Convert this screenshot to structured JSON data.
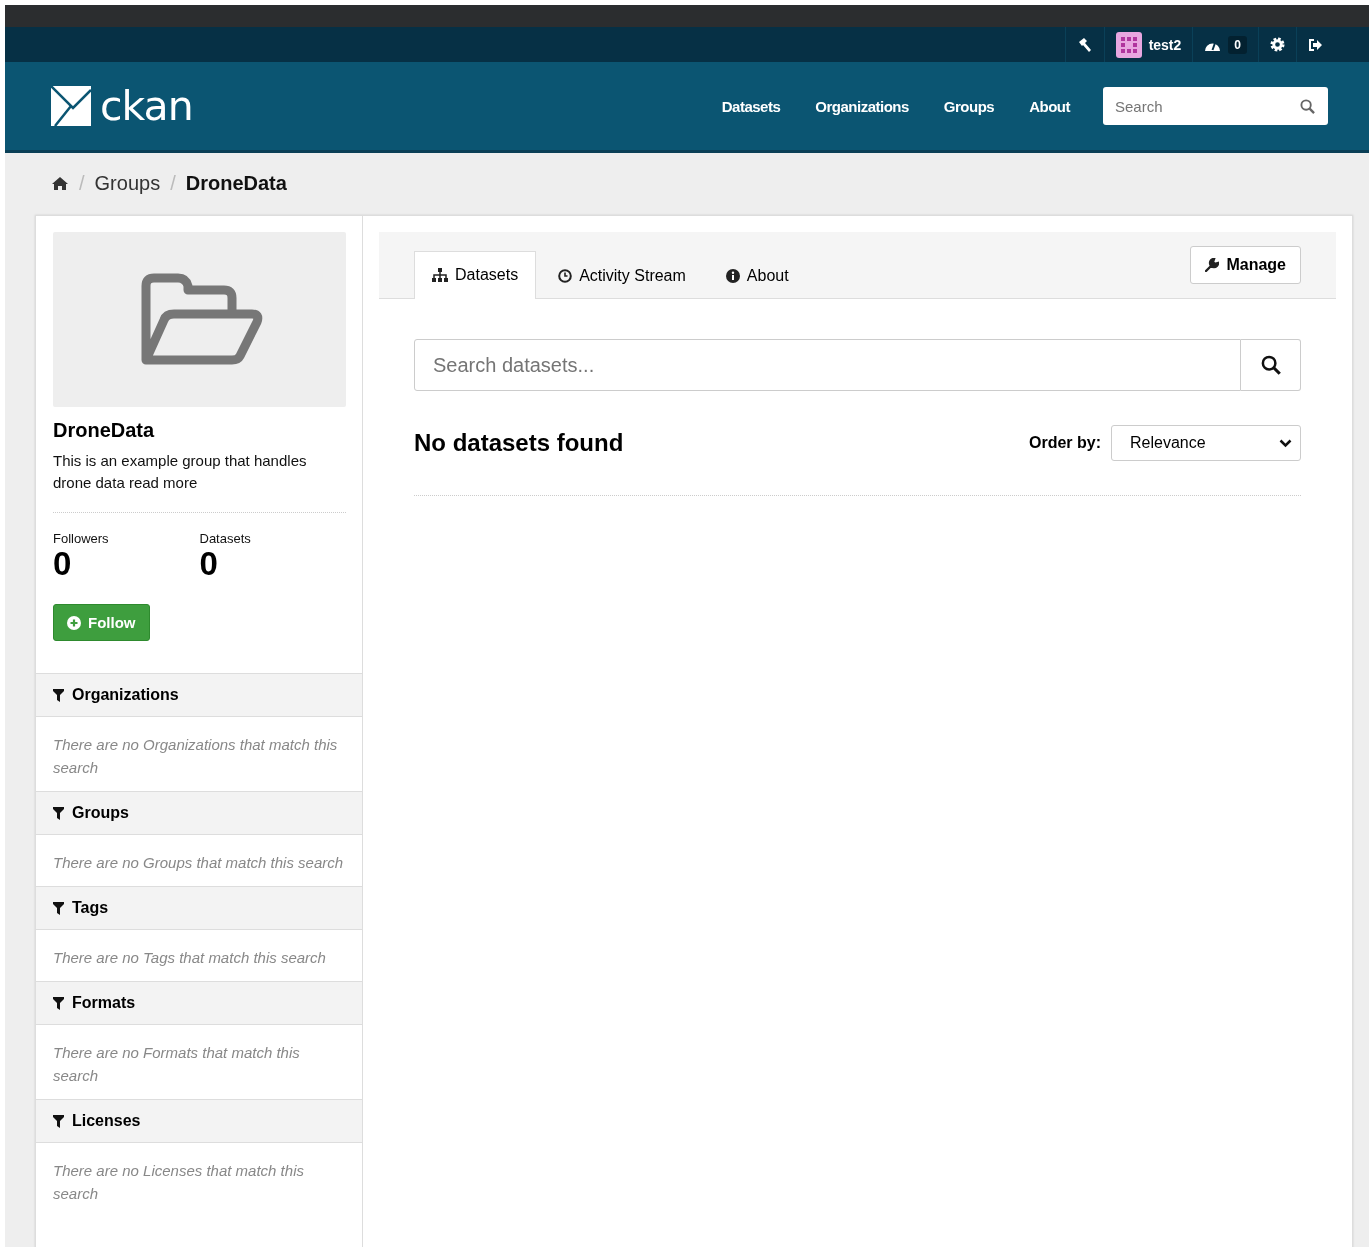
{
  "account_bar": {
    "user": "test2",
    "dashboard_count": "0"
  },
  "header": {
    "logo": "ckan",
    "nav": [
      {
        "label": "Datasets"
      },
      {
        "label": "Organizations"
      },
      {
        "label": "Groups"
      },
      {
        "label": "About"
      }
    ],
    "search": {
      "placeholder": "Search"
    }
  },
  "breadcrumb": [
    {
      "separator": "/",
      "label": "Groups"
    },
    {
      "separator": "/",
      "label": "DroneData"
    }
  ],
  "group": {
    "name": "DroneData",
    "description": "This is an example group that handles drone data read more",
    "stats": [
      {
        "label": "Followers",
        "value": "0"
      },
      {
        "label": "Datasets",
        "value": "0"
      }
    ],
    "follow_button": "Follow"
  },
  "facets": [
    {
      "title": "Organizations",
      "empty_text": "There are no Organizations that match this search"
    },
    {
      "title": "Groups",
      "empty_text": "There are no Groups that match this search"
    },
    {
      "title": "Tags",
      "empty_text": "There are no Tags that match this search"
    },
    {
      "title": "Formats",
      "empty_text": "There are no Formats that match this search"
    },
    {
      "title": "Licenses",
      "empty_text": "There are no Licenses that match this search"
    }
  ],
  "tabs": [
    {
      "label": "Datasets",
      "kind": "sitemap",
      "selected": true
    },
    {
      "label": "Activity Stream",
      "kind": "clock",
      "selected": false
    },
    {
      "label": "About",
      "kind": "info",
      "selected": false
    }
  ],
  "manage_button": "Manage",
  "dataset_search": {
    "placeholder": "Search datasets..."
  },
  "results_title": "No datasets found",
  "order_by": {
    "label": "Order by:",
    "value": "Relevance"
  }
}
